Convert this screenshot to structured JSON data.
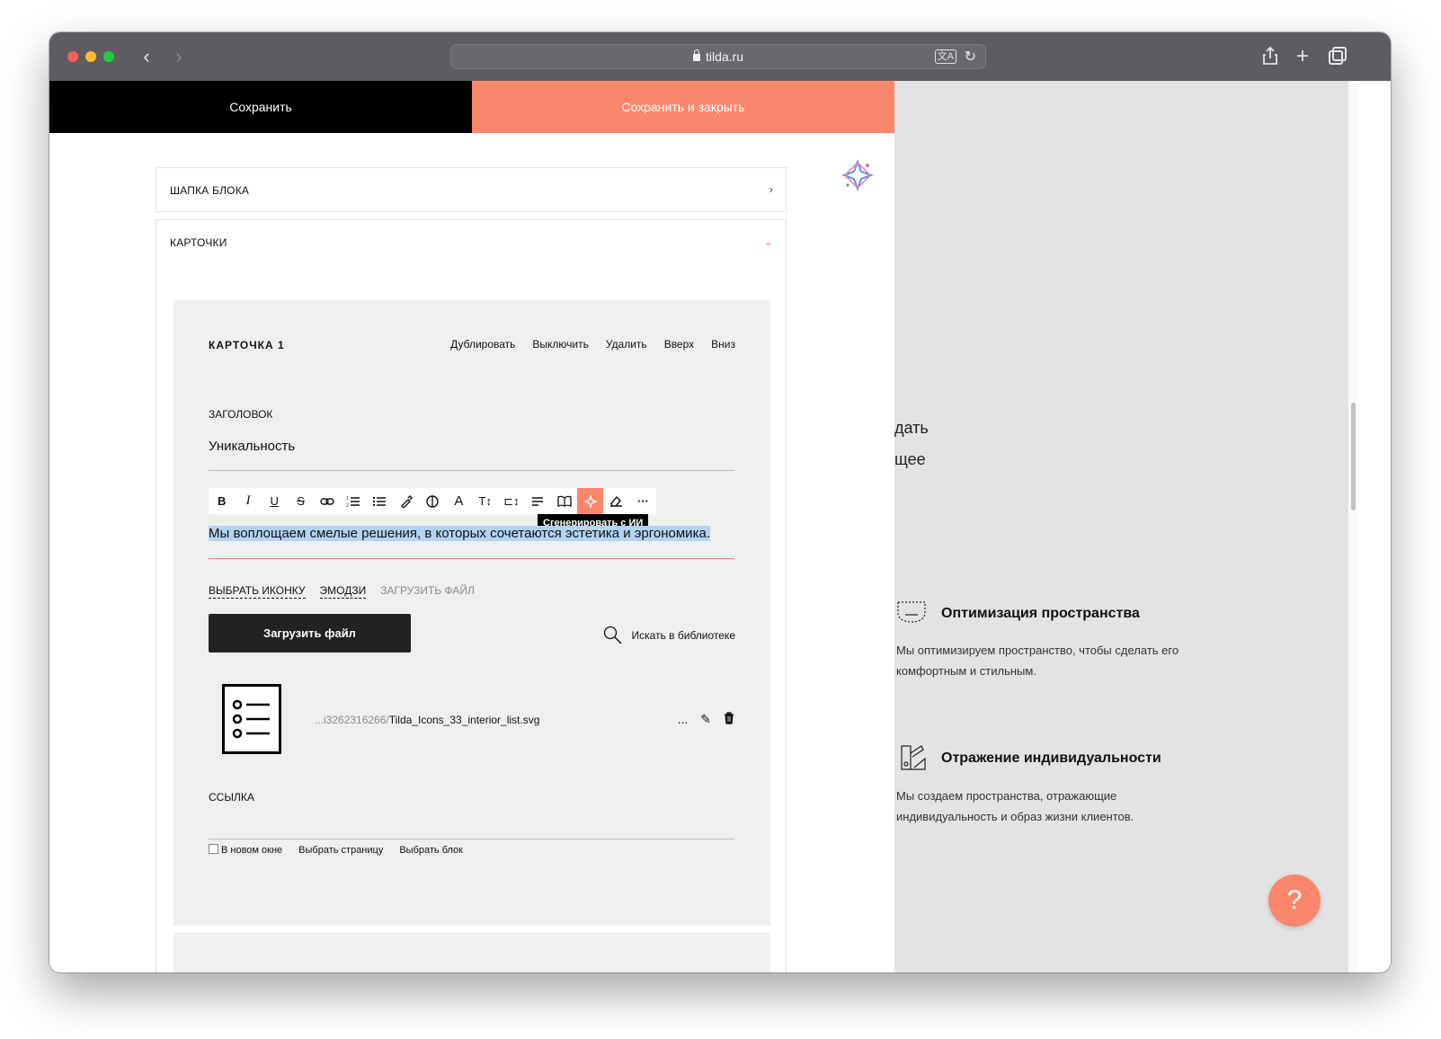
{
  "browser": {
    "url": "tilda.ru",
    "back_icon": "chevron-left-icon",
    "forward_icon": "chevron-right-icon"
  },
  "editor": {
    "save_label": "Сохранить",
    "save_close_label": "Сохранить и закрыть",
    "accordion_header": "ШАПКА БЛОКА",
    "accordion_cards": "КАРТОЧКИ",
    "card": {
      "title": "КАРТОЧКА 1",
      "actions": [
        "Дублировать",
        "Выключить",
        "Удалить",
        "Вверх",
        "Вниз"
      ],
      "heading_label": "ЗАГОЛОВОК",
      "heading_value": "Уникальность",
      "description": "Мы воплощаем смелые решения, в которых сочетаются эстетика и эргономика.",
      "tooltip": "Сгенерировать с ИИ",
      "icon_tabs": [
        "ВЫБРАТЬ ИКОНКУ",
        "ЭМОДЗИ",
        "ЗАГРУЗИТЬ ФАЙЛ"
      ],
      "upload_button": "Загрузить файл",
      "library_search": "Искать в библиотеке",
      "file_path_prefix": "...i3262316266/",
      "file_name": "Tilda_Icons_33_interior_list.svg",
      "file_more": "...",
      "link_label": "ССЫЛКА",
      "link_new_window": "В новом окне",
      "link_choose_page": "Выбрать страницу",
      "link_choose_block": "Выбрать блок"
    }
  },
  "preview": {
    "fragment1": "дать",
    "fragment2": "щее",
    "items": [
      {
        "title": "Оптимизация пространства",
        "text": "Мы оптимизируем пространство, чтобы сделать его комфортным и стильным."
      },
      {
        "title": "Отражение индивидуальности",
        "text": "Мы создаем пространства, отражающие индивидуальность и образ жизни клиентов."
      }
    ],
    "help_label": "?"
  },
  "colors": {
    "accent": "#fa876b",
    "selection": "#b4d2f2"
  }
}
